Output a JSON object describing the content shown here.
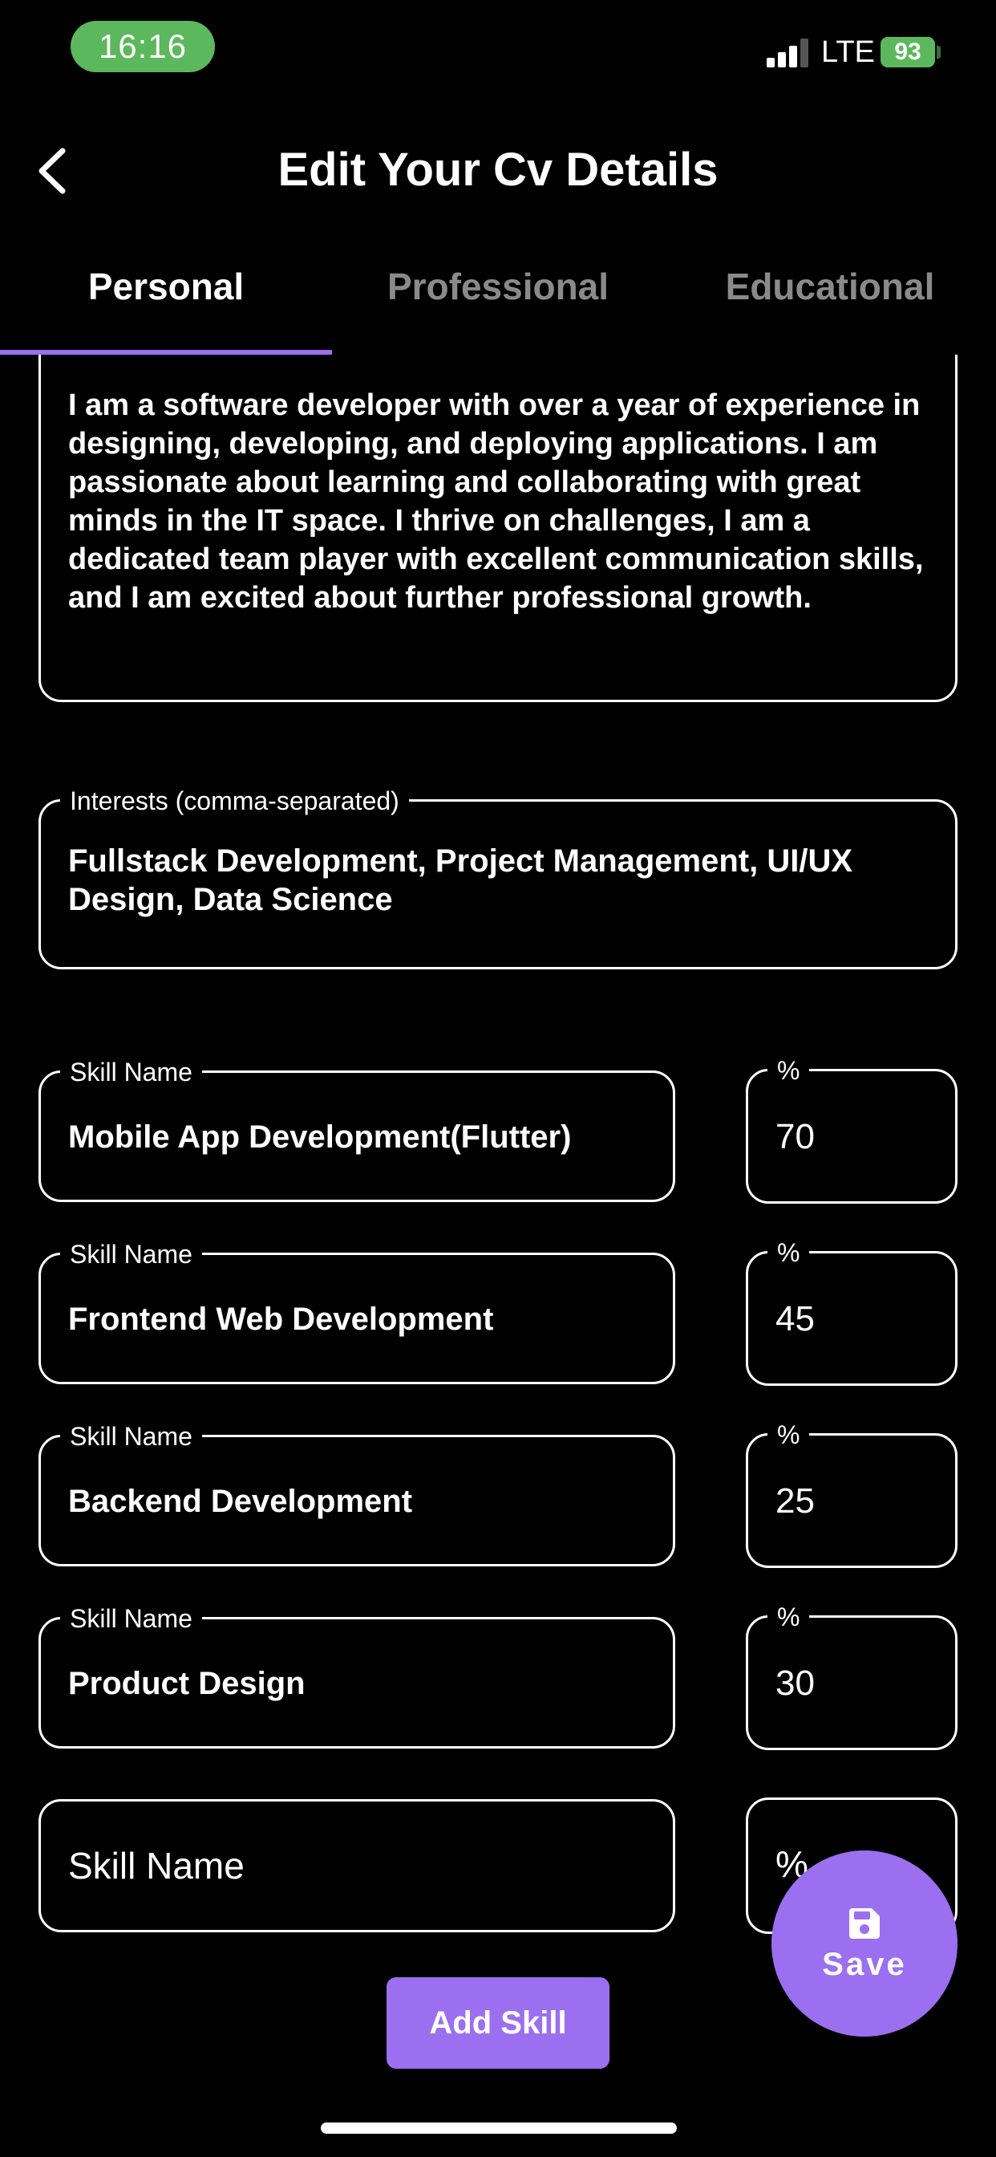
{
  "status_bar": {
    "time": "16:16",
    "network": "LTE",
    "battery": "93"
  },
  "header": {
    "title": "Edit Your Cv Details"
  },
  "tabs": [
    {
      "label": "Personal",
      "active": true
    },
    {
      "label": "Professional",
      "active": false
    },
    {
      "label": "Educational",
      "active": false
    }
  ],
  "about": {
    "value": "I am a software developer with over a year of experience in designing, developing, and deploying applications. I am passionate about learning and collaborating with great minds in the IT space. I thrive on challenges, I am a dedicated team player with excellent communication skills, and I am excited about further professional growth."
  },
  "interests": {
    "label": "Interests (comma-separated)",
    "value": "Fullstack Development, Project Management, UI/UX Design, Data Science"
  },
  "skills": [
    {
      "name_label": "Skill Name",
      "name": "Mobile App Development(Flutter)",
      "percent_label": "%",
      "percent": "70"
    },
    {
      "name_label": "Skill Name",
      "name": "Frontend Web Development",
      "percent_label": "%",
      "percent": "45"
    },
    {
      "name_label": "Skill Name",
      "name": "Backend Development",
      "percent_label": "%",
      "percent": "25"
    },
    {
      "name_label": "Skill Name",
      "name": "Product Design",
      "percent_label": "%",
      "percent": "30"
    }
  ],
  "new_skill": {
    "name_placeholder": "Skill Name",
    "percent_placeholder": "%"
  },
  "buttons": {
    "add_skill": "Add Skill",
    "save": "Save"
  },
  "colors": {
    "accent": "#9b6ff0",
    "status_green": "#5cb85c",
    "background": "#000000"
  }
}
